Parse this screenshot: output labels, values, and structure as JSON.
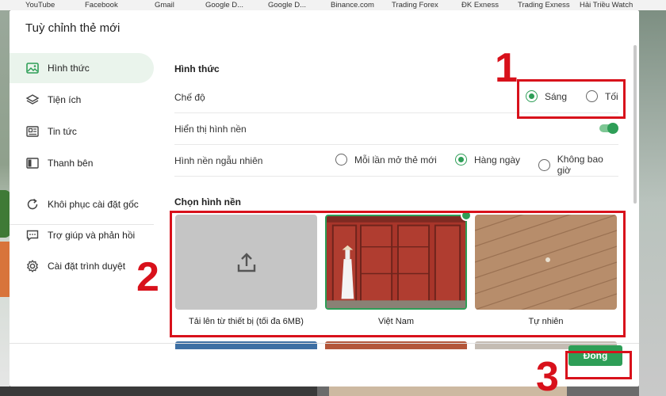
{
  "bookmarks": [
    "YouTube",
    "Facebook",
    "Gmail",
    "Google D...",
    "Google D...",
    "Binance.com",
    "Trading Forex",
    "ĐK Exness",
    "Trading Exness",
    "Hải Triều Watch"
  ],
  "dialog": {
    "title": "Tuỳ chỉnh thẻ mới"
  },
  "sidebar": {
    "items": [
      {
        "label": "Hình thức",
        "icon": "image-icon",
        "active": true
      },
      {
        "label": "Tiện ích",
        "icon": "layers-icon"
      },
      {
        "label": "Tin tức",
        "icon": "news-icon"
      },
      {
        "label": "Thanh bên",
        "icon": "sidebar-icon"
      },
      {
        "label": "Khôi phục cài đặt gốc",
        "icon": "reset-icon"
      },
      {
        "label": "Trợ giúp và phản hồi",
        "icon": "help-chat-icon"
      },
      {
        "label": "Cài đặt trình duyệt",
        "icon": "gear-icon"
      }
    ]
  },
  "main": {
    "section_title": "Hình thức",
    "mode": {
      "label": "Chế độ",
      "options": [
        "Sáng",
        "Tối"
      ],
      "selected": "Sáng"
    },
    "show_wallpaper": {
      "label": "Hiển thị hình nền",
      "enabled": true
    },
    "random_wallpaper": {
      "label": "Hình nền ngẫu nhiên",
      "options": [
        "Mỗi lần mở thẻ mới",
        "Hàng ngày",
        "Không bao giờ"
      ],
      "selected": "Hàng ngày"
    },
    "wallpaper_section_title": "Chọn hình nền",
    "wallpapers": [
      {
        "label": "Tải lên từ thiết bị (tối đa 6MB)",
        "icon": "upload-icon"
      },
      {
        "label": "Việt Nam",
        "selected": true
      },
      {
        "label": "Tự nhiên"
      }
    ]
  },
  "footer": {
    "close_label": "Đóng"
  },
  "annotations": [
    "1",
    "2",
    "3"
  ],
  "colors": {
    "accent": "#2e9e57",
    "annotation": "#d8111b"
  }
}
